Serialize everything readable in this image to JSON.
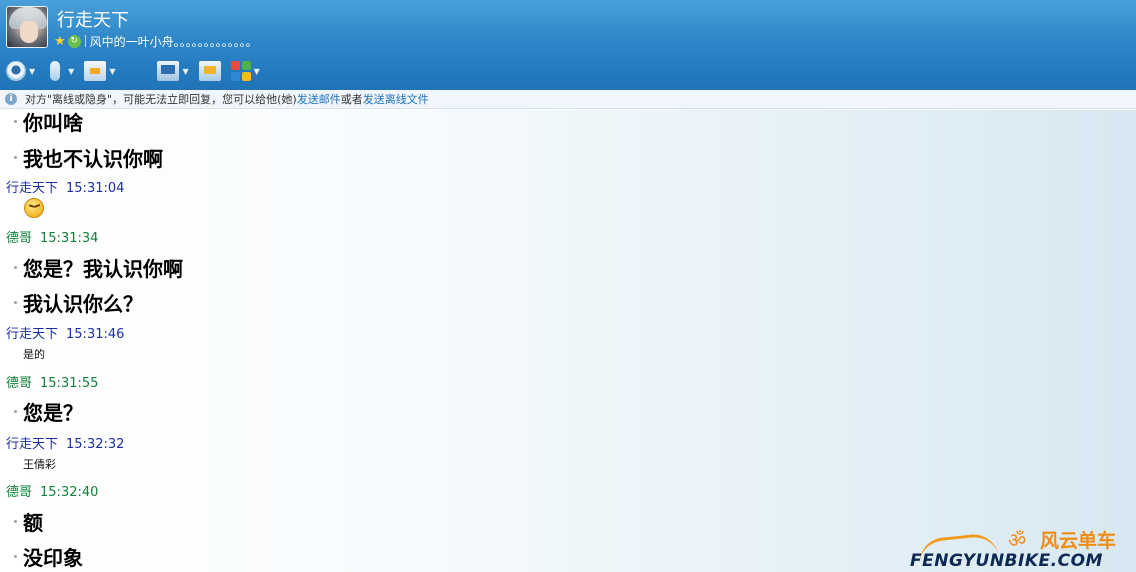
{
  "header": {
    "contact_name": "行走天下",
    "signature": "风中的一叶小舟。。。。。。。。。。。。。",
    "toolbar": [
      "video-call",
      "voice-call",
      "send-file",
      "create-discussion",
      "remote-assist",
      "share-screen",
      "apps"
    ]
  },
  "infobar": {
    "text_before": "对方\"离线或隐身\"，可能无法立即回复，您可以给他(她)",
    "link_email": "发送邮件",
    "text_middle": "或者",
    "link_offline_file": "发送离线文件"
  },
  "messages": [
    {
      "type": "line",
      "text": "你叫啥",
      "size": "big"
    },
    {
      "type": "line",
      "text": "我也不认识你啊",
      "size": "big"
    },
    {
      "type": "header",
      "sender": "行走天下",
      "time": "15:31:04",
      "who": "me"
    },
    {
      "type": "emoji",
      "icon": "grin-emoji-icon"
    },
    {
      "type": "header",
      "sender": "德哥",
      "time": "15:31:34",
      "who": "them"
    },
    {
      "type": "line",
      "text": "您是？我认识你啊",
      "size": "big"
    },
    {
      "type": "line",
      "text": "我认识你么？",
      "size": "big"
    },
    {
      "type": "header",
      "sender": "行走天下",
      "time": "15:31:46",
      "who": "me"
    },
    {
      "type": "line",
      "text": "是的",
      "size": "small"
    },
    {
      "type": "header",
      "sender": "德哥",
      "time": "15:31:55",
      "who": "them"
    },
    {
      "type": "line",
      "text": "您是？",
      "size": "big"
    },
    {
      "type": "header",
      "sender": "行走天下",
      "time": "15:32:32",
      "who": "me"
    },
    {
      "type": "line",
      "text": "王倩彩",
      "size": "small"
    },
    {
      "type": "header",
      "sender": "德哥",
      "time": "15:32:40",
      "who": "them"
    },
    {
      "type": "line",
      "text": "额",
      "size": "big"
    },
    {
      "type": "line",
      "text": "没印象",
      "size": "big"
    }
  ],
  "watermark": {
    "cn": "风云单车",
    "en": "FENGYUNBIKE.COM",
    "accent": "#f08c12"
  }
}
